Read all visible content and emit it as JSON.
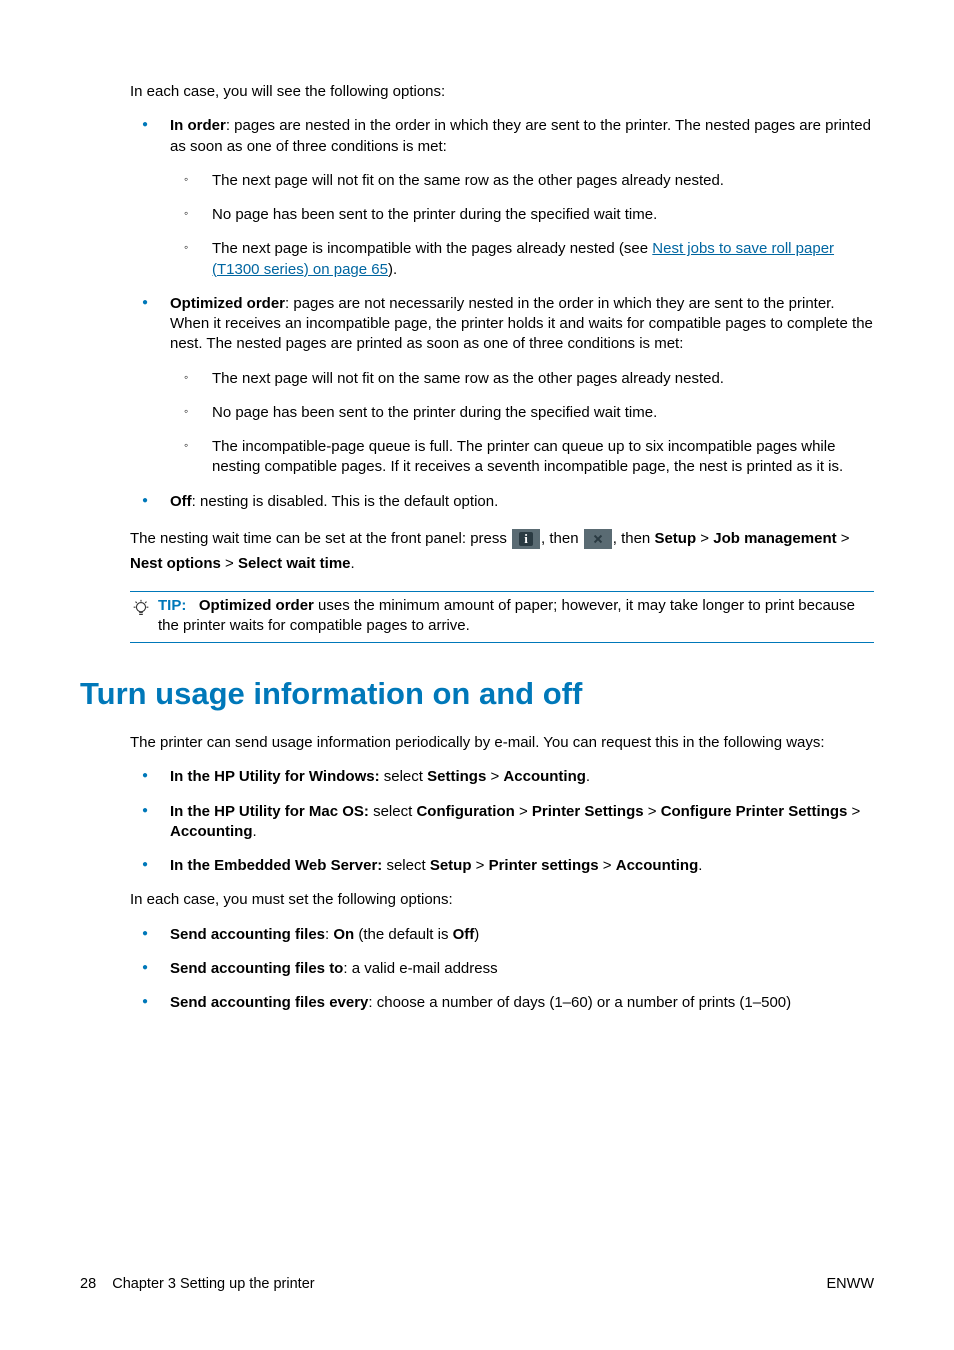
{
  "intro": "In each case, you will see the following options:",
  "opt_in_order_label": "In order",
  "opt_in_order_text": ": pages are nested in the order in which they are sent to the printer. The nested pages are printed as soon as one of three conditions is met:",
  "io_sub1": "The next page will not fit on the same row as the other pages already nested.",
  "io_sub2": "No page has been sent to the printer during the specified wait time.",
  "io_sub3_a": "The next page is incompatible with the pages already nested (see ",
  "io_sub3_link": "Nest jobs to save roll paper (T1300 series) on page 65",
  "io_sub3_b": ").",
  "opt_optimized_label": "Optimized order",
  "opt_optimized_text": ": pages are not necessarily nested in the order in which they are sent to the printer. When it receives an incompatible page, the printer holds it and waits for compatible pages to complete the nest. The nested pages are printed as soon as one of three conditions is met:",
  "oo_sub1": "The next page will not fit on the same row as the other pages already nested.",
  "oo_sub2": "No page has been sent to the printer during the specified wait time.",
  "oo_sub3": "The incompatible-page queue is full. The printer can queue up to six incompatible pages while nesting compatible pages. If it receives a seventh incompatible page, the nest is printed as it is.",
  "opt_off_label": "Off",
  "opt_off_text": ": nesting is disabled. This is the default option.",
  "wait_a": "The nesting wait time can be set at the front panel: press ",
  "wait_b": ", then ",
  "wait_c": ", then ",
  "wait_setup": "Setup",
  "wait_gt1": " > ",
  "wait_job": "Job management",
  "wait_gt2": " > ",
  "wait_nest": "Nest options",
  "wait_gt3": " > ",
  "wait_select": "Select wait time",
  "wait_end": ".",
  "tip_label": "TIP:",
  "tip_bold": "Optimized order",
  "tip_rest": " uses the minimum amount of paper; however, it may take longer to print because the printer waits for compatible pages to arrive.",
  "heading": "Turn usage information on and off",
  "usage_intro": "The printer can send usage information periodically by e-mail. You can request this in the following ways:",
  "u1_a": "In the HP Utility for Windows:",
  "u1_b": " select ",
  "u1_c": "Settings",
  "u1_d": " > ",
  "u1_e": "Accounting",
  "u1_f": ".",
  "u2_a": "In the HP Utility for Mac OS:",
  "u2_b": " select ",
  "u2_c": "Configuration",
  "u2_d": " > ",
  "u2_e": "Printer Settings",
  "u2_f": " > ",
  "u2_g": "Configure Printer Settings",
  "u2_h": " > ",
  "u2_i": "Accounting",
  "u2_j": ".",
  "u3_a": "In the Embedded Web Server:",
  "u3_b": " select ",
  "u3_c": "Setup",
  "u3_d": " > ",
  "u3_e": "Printer settings",
  "u3_f": " > ",
  "u3_g": "Accounting",
  "u3_h": ".",
  "must_set": "In each case, you must set the following options:",
  "s1_a": "Send accounting files",
  "s1_b": ": ",
  "s1_c": "On",
  "s1_d": " (the default is ",
  "s1_e": "Off",
  "s1_f": ")",
  "s2_a": "Send accounting files to",
  "s2_b": ": a valid e-mail address",
  "s3_a": "Send accounting files every",
  "s3_b": ": choose a number of days (1–60) or a number of prints (1–500)",
  "footer_page": "28",
  "footer_chapter": "Chapter 3   Setting up the printer",
  "footer_right": "ENWW"
}
